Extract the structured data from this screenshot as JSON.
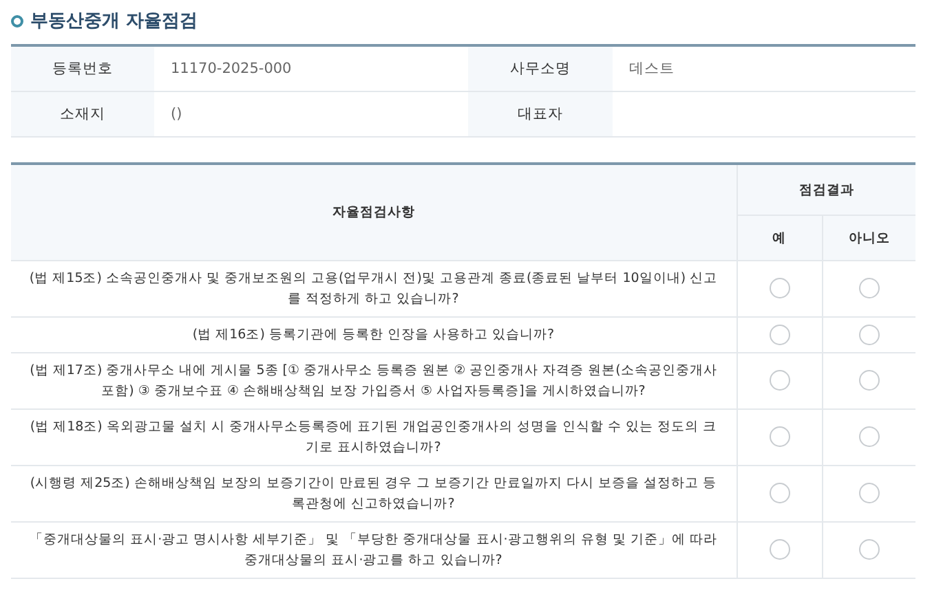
{
  "section_title": "부동산중개 자율점검",
  "info": [
    {
      "label": "등록번호",
      "value": "11170-2025-000"
    },
    {
      "label": "사무소명",
      "value": "데스트"
    },
    {
      "label": "소재지",
      "value": "()"
    },
    {
      "label": "대표자"
    }
  ],
  "checklist": {
    "columns": {
      "item": "자율점검사항",
      "result": "점검결과",
      "yes": "예",
      "no": "아니오"
    },
    "rows": [
      {
        "text": "(법 제15조) 소속공인중개사 및 중개보조원의 고용(업무개시 전)및 고용관계 종료(종료된 날부터 10일이내) 신고를 적정하게 하고 있습니까?",
        "yes": false,
        "no": false
      },
      {
        "text": "(법 제16조) 등록기관에 등록한 인장을 사용하고 있습니까?",
        "yes": false,
        "no": false
      },
      {
        "text": "(법 제17조) 중개사무소 내에 게시물 5종 [① 중개사무소 등록증 원본 ② 공인중개사 자격증 원본(소속공인중개사 포함) ③ 중개보수표 ④ 손해배상책임 보장 가입증서 ⑤ 사업자등록증]을 게시하였습니까?",
        "yes": false,
        "no": false
      },
      {
        "text": "(법 제18조) 옥외광고물 설치 시 중개사무소등록증에 표기된 개업공인중개사의 성명을 인식할 수 있는 정도의 크기로 표시하였습니까?",
        "yes": false,
        "no": false
      },
      {
        "text": "(시행령 제25조) 손해배상책임 보장의 보증기간이 만료된 경우 그 보증기간 만료일까지 다시 보증을 설정하고 등록관청에 신고하였습니까?",
        "yes": false,
        "no": false
      },
      {
        "text": "「중개대상물의 표시·광고 명시사항 세부기준」 및 「부당한 중개대상물 표시·광고행위의 유형 및 기준」에 따라 중개대상물의 표시·광고를 하고 있습니까?",
        "yes": false,
        "no": false
      }
    ]
  }
}
